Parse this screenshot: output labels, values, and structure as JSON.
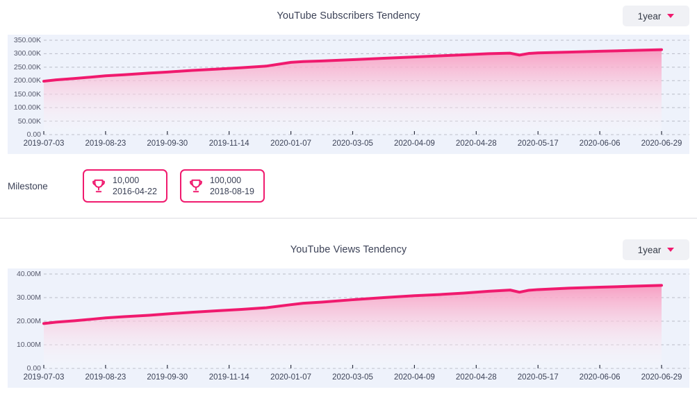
{
  "theme": {
    "accent": "#f01a6e",
    "chart_bg": "#eef2fb",
    "grid": "#b9bcc7",
    "text": "#3c4257",
    "select_bg": "#f0f1f5",
    "divider": "#dcdde2",
    "area_top": "#f79ec2",
    "area_bottom": "#ffffff"
  },
  "panels": [
    {
      "id": "subscribers",
      "title": "YouTube Subscribers Tendency",
      "range": {
        "label": "1year",
        "caret_icon": "chevron-down-icon"
      }
    },
    {
      "id": "views",
      "title": "YouTube Views Tendency",
      "range": {
        "label": "1year",
        "caret_icon": "chevron-down-icon"
      }
    }
  ],
  "milestone": {
    "label": "Milestone",
    "items": [
      {
        "icon": "trophy-icon",
        "count": "10,000",
        "date": "2016-04-22"
      },
      {
        "icon": "trophy-icon",
        "count": "100,000",
        "date": "2018-08-19"
      }
    ]
  },
  "chart_data": [
    {
      "type": "area",
      "id": "subscribers",
      "title": "YouTube Subscribers Tendency",
      "xlabel": "",
      "ylabel": "",
      "grid": true,
      "legend": false,
      "ylim": [
        0,
        350000
      ],
      "ytick_labels": [
        "350.00K",
        "300.00K",
        "250.00K",
        "200.00K",
        "150.00K",
        "100.00K",
        "50.00K",
        "0.00"
      ],
      "yticks": [
        350000,
        300000,
        250000,
        200000,
        150000,
        100000,
        50000,
        0
      ],
      "categories": [
        "2019-07-03",
        "2019-08-23",
        "2019-09-30",
        "2019-11-14",
        "2020-01-07",
        "2020-03-05",
        "2020-04-09",
        "2020-04-28",
        "2020-05-17",
        "2020-06-06",
        "2020-06-29"
      ],
      "x": [
        0,
        0.02,
        0.05,
        0.08,
        0.1,
        0.13,
        0.17,
        0.2,
        0.24,
        0.28,
        0.32,
        0.36,
        0.4,
        0.42,
        0.45,
        0.5,
        0.55,
        0.6,
        0.64,
        0.68,
        0.72,
        0.755,
        0.77,
        0.785,
        0.8,
        0.85,
        0.9,
        0.95,
        1
      ],
      "values": [
        198000,
        203000,
        208000,
        214000,
        218000,
        222000,
        228000,
        232000,
        238000,
        243000,
        248000,
        254000,
        268000,
        271000,
        273000,
        278000,
        283000,
        288000,
        292000,
        296000,
        300000,
        302000,
        295000,
        301000,
        303000,
        306000,
        309000,
        312000,
        315000
      ],
      "series_color": "#f01a6e",
      "notes": "Monotonic rising area chart with a sharp single-day dip near 2020-05-17"
    },
    {
      "type": "area",
      "id": "views",
      "title": "YouTube Views Tendency",
      "xlabel": "",
      "ylabel": "",
      "grid": true,
      "legend": false,
      "ylim": [
        0,
        40000000
      ],
      "ytick_labels": [
        "40.00M",
        "30.00M",
        "20.00M",
        "10.00M",
        "0.00"
      ],
      "yticks": [
        40000000,
        30000000,
        20000000,
        10000000,
        0
      ],
      "categories": [
        "2019-07-03",
        "2019-08-23",
        "2019-09-30",
        "2019-11-14",
        "2020-01-07",
        "2020-03-05",
        "2020-04-09",
        "2020-04-28",
        "2020-05-17",
        "2020-06-06",
        "2020-06-29"
      ],
      "x": [
        0,
        0.02,
        0.05,
        0.08,
        0.1,
        0.13,
        0.17,
        0.2,
        0.24,
        0.28,
        0.32,
        0.36,
        0.4,
        0.42,
        0.45,
        0.5,
        0.55,
        0.6,
        0.64,
        0.68,
        0.72,
        0.755,
        0.77,
        0.785,
        0.8,
        0.85,
        0.9,
        0.95,
        1
      ],
      "values": [
        19000000,
        19600000,
        20200000,
        20900000,
        21400000,
        21900000,
        22500000,
        23100000,
        23800000,
        24400000,
        25000000,
        25700000,
        27000000,
        27600000,
        28100000,
        29100000,
        30000000,
        30800000,
        31300000,
        31900000,
        32700000,
        33200000,
        32300000,
        33100000,
        33400000,
        34000000,
        34400000,
        34800000,
        35200000
      ],
      "series_color": "#f01a6e",
      "notes": "Monotonic rising area chart with a sharp single-day dip near 2020-05-17"
    }
  ]
}
